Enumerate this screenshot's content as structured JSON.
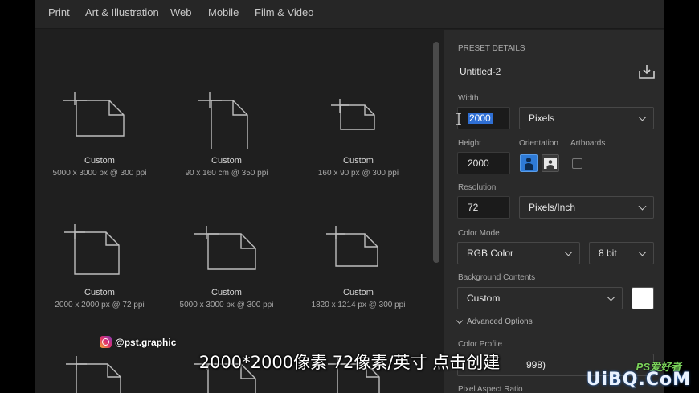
{
  "tabs": [
    "Print",
    "Art & Illustration",
    "Web",
    "Mobile",
    "Film & Video"
  ],
  "presets": [
    {
      "name": "Custom",
      "size": "5000 x 3000 px @ 300 ppi"
    },
    {
      "name": "Custom",
      "size": "90 x 160 cm @ 350 ppi"
    },
    {
      "name": "Custom",
      "size": "160 x 90 px @ 300 ppi"
    },
    {
      "name": "Custom",
      "size": "2000 x 2000 px @ 72 ppi"
    },
    {
      "name": "Custom",
      "size": "5000 x 3000 px @ 300 ppi"
    },
    {
      "name": "Custom",
      "size": "1820 x 1214 px @ 300 ppi"
    }
  ],
  "panel": {
    "section_title": "PRESET DETAILS",
    "doc_name": "Untitled-2",
    "width_label": "Width",
    "width_value": "2000",
    "width_unit": "Pixels",
    "height_label": "Height",
    "height_value": "2000",
    "orientation_label": "Orientation",
    "artboards_label": "Artboards",
    "resolution_label": "Resolution",
    "resolution_value": "72",
    "resolution_unit": "Pixels/Inch",
    "color_mode_label": "Color Mode",
    "color_mode_value": "RGB Color",
    "bit_depth": "8 bit",
    "background_label": "Background Contents",
    "background_value": "Custom",
    "background_color": "#ffffff",
    "advanced_label": "Advanced Options",
    "color_profile_label": "Color Profile",
    "color_profile_partial": "998)",
    "pixel_aspect_label": "Pixel Aspect Ratio"
  },
  "overlay": {
    "subtitle": "2000*2000像素 72像素/英寸 点击创建",
    "handle": "@pst.graphic",
    "watermark_main": "UiBQ.CoM",
    "watermark_ps": "PS爱好者"
  },
  "colors": {
    "accent": "#2e7ad6",
    "app_bg": "#1f1f1f",
    "panel_bg": "#2a2a2a"
  }
}
